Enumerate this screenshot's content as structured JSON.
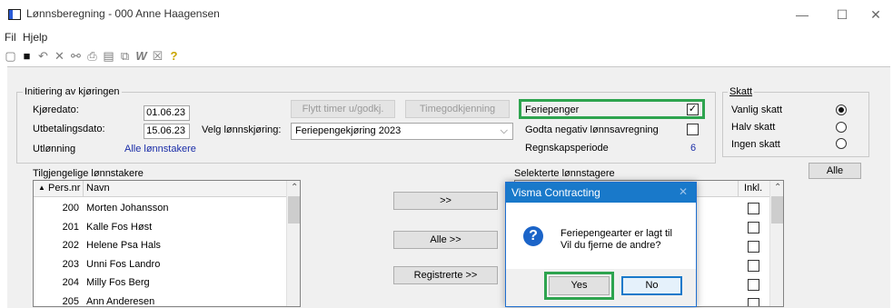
{
  "window": {
    "title": "Lønnsberegning - 000 Anne Haagensen",
    "minimize": "—",
    "maximize": "☐",
    "close": "✕"
  },
  "menu": [
    "Fil",
    "Hjelp"
  ],
  "toolbar": {
    "icons": [
      "new-icon",
      "save-icon",
      "undo-icon",
      "delete-icon",
      "find-icon",
      "print-icon",
      "preview-icon",
      "copy-icon",
      "word-icon",
      "excel-icon",
      "help-icon"
    ],
    "glyphs": [
      "▢",
      "■",
      "↶",
      "✕",
      "⚯",
      "⎙",
      "▤",
      "⧉",
      "W",
      "☒",
      "?"
    ]
  },
  "init": {
    "group_label": "Initiering av kjøringen",
    "kjoredato_label": "Kjøredato:",
    "kjoredato": "01.06.23",
    "utbetaling_label": "Utbetalingsdato:",
    "utbetaling": "15.06.23",
    "utlonning_label": "Utlønning",
    "utlonning_link": "Alle lønnstakere",
    "velg_label": "Velg lønnskjøring:",
    "velg_value": "Feriepengekjøring 2023",
    "flytt_button": "Flytt timer u/godkj.",
    "timegodkjenning_button": "Timegodkjenning",
    "feriepenger_label": "Feriepenger",
    "feriepenger_checked": "✓",
    "godta_label": "Godta negativ lønnsavregning",
    "regnskap_label": "Regnskapsperiode",
    "regnskap_value": "6"
  },
  "skatt": {
    "group_label": "Skatt",
    "options": [
      "Vanlig skatt",
      "Halv skatt",
      "Ingen skatt"
    ],
    "selected": "Vanlig skatt",
    "alle_button": "Alle"
  },
  "left_list": {
    "label": "Tilgjengelige lønnstakere",
    "col_nr": "Pers.nr",
    "col_navn": "Navn",
    "sort_glyph": "▲",
    "rows": [
      {
        "nr": "200",
        "navn": "Morten Johansson"
      },
      {
        "nr": "201",
        "navn": "Kalle Fos Høst"
      },
      {
        "nr": "202",
        "navn": "Helene Psa Hals"
      },
      {
        "nr": "203",
        "navn": "Unni Fos Landro"
      },
      {
        "nr": "204",
        "navn": "Milly Fos Berg"
      },
      {
        "nr": "205",
        "navn": "Ann Anderesen"
      }
    ]
  },
  "mid_buttons": {
    "move": ">>",
    "all": "Alle >>",
    "registered": "Registrerte >>"
  },
  "right_list": {
    "label": "Selekterte lønnstagere",
    "col_inkl": "Inkl."
  },
  "dialog": {
    "title": "Visma Contracting",
    "close": "✕",
    "line1": "Feriepengearter er lagt til",
    "line2": "Vil du fjerne de andre?",
    "yes": "Yes",
    "no": "No"
  }
}
